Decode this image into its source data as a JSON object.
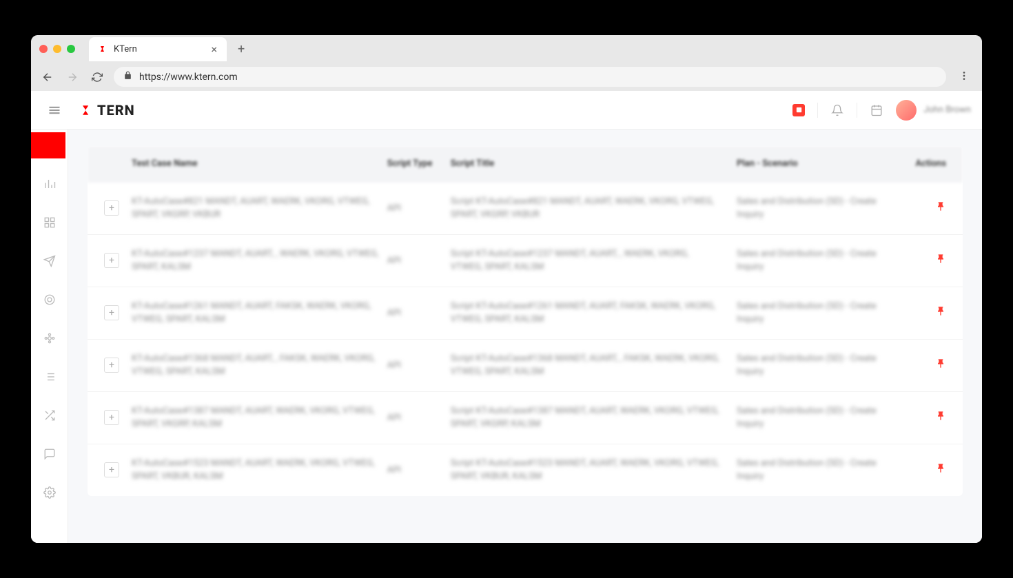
{
  "browser": {
    "tab_title": "KTern",
    "url": "https://www.ktern.com"
  },
  "app": {
    "logo_text": "TERN",
    "user_name": "John Brown"
  },
  "table": {
    "headers": {
      "name": "Test Case Name",
      "type": "Script Type",
      "title": "Script Title",
      "plan": "Plan - Scenario",
      "actions": "Actions"
    },
    "rows": [
      {
        "name": "KT-AutoCase#821 MANDT, AUART, WAERK, VKORG, VTWEG, SPART, VKGRP, VKBUR",
        "type": "API",
        "title": "Script KT-AutoCase#821 MANDT, AUART, WAERK, VKORG, VTWEG, SPART, VKGRP, VKBUR",
        "plan": "Sales and Distribution (SD) - Create Inquiry"
      },
      {
        "name": "KT-AutoCase#1237 MANDT, AUART, , WAERK, VKORG, VTWEG, SPART, KALSM",
        "type": "API",
        "title": "Script KT-AutoCase#1237 MANDT, AUART, , WAERK, VKORG, VTWEG, SPART, KALSM",
        "plan": "Sales and Distribution (SD) - Create Inquiry"
      },
      {
        "name": "KT-AutoCase#1261 MANDT, AUART, FAKSK, WAERK, VKORG, VTWEG, SPART, KALSM",
        "type": "API",
        "title": "Script KT-AutoCase#1261 MANDT, AUART, FAKSK, WAERK, VKORG, VTWEG, SPART, KALSM",
        "plan": "Sales and Distribution (SD) - Create Inquiry"
      },
      {
        "name": "KT-AutoCase#1368 MANDT, AUART, , FAKSK, WAERK, VKORG, VTWEG, SPART, KALSM",
        "type": "API",
        "title": "Script KT-AutoCase#1368 MANDT, AUART, , FAKSK, WAERK, VKORG, VTWEG, SPART, KALSM",
        "plan": "Sales and Distribution (SD) - Create Inquiry"
      },
      {
        "name": "KT-AutoCase#1387 MANDT, AUART, WAERK, VKORG, VTWEG, SPART, VKGRP, KALSM",
        "type": "API",
        "title": "Script KT-AutoCase#1387 MANDT, AUART, WAERK, VKORG, VTWEG, SPART, VKGRP, KALSM",
        "plan": "Sales and Distribution (SD) - Create Inquiry"
      },
      {
        "name": "KT-AutoCase#1523 MANDT, AUART, WAERK, VKORG, VTWEG, SPART, VKBUR, KALSM",
        "type": "API",
        "title": "Script KT-AutoCase#1523 MANDT, AUART, WAERK, VKORG, VTWEG, SPART, VKBUR, KALSM",
        "plan": "Sales and Distribution (SD) - Create Inquiry"
      }
    ]
  }
}
